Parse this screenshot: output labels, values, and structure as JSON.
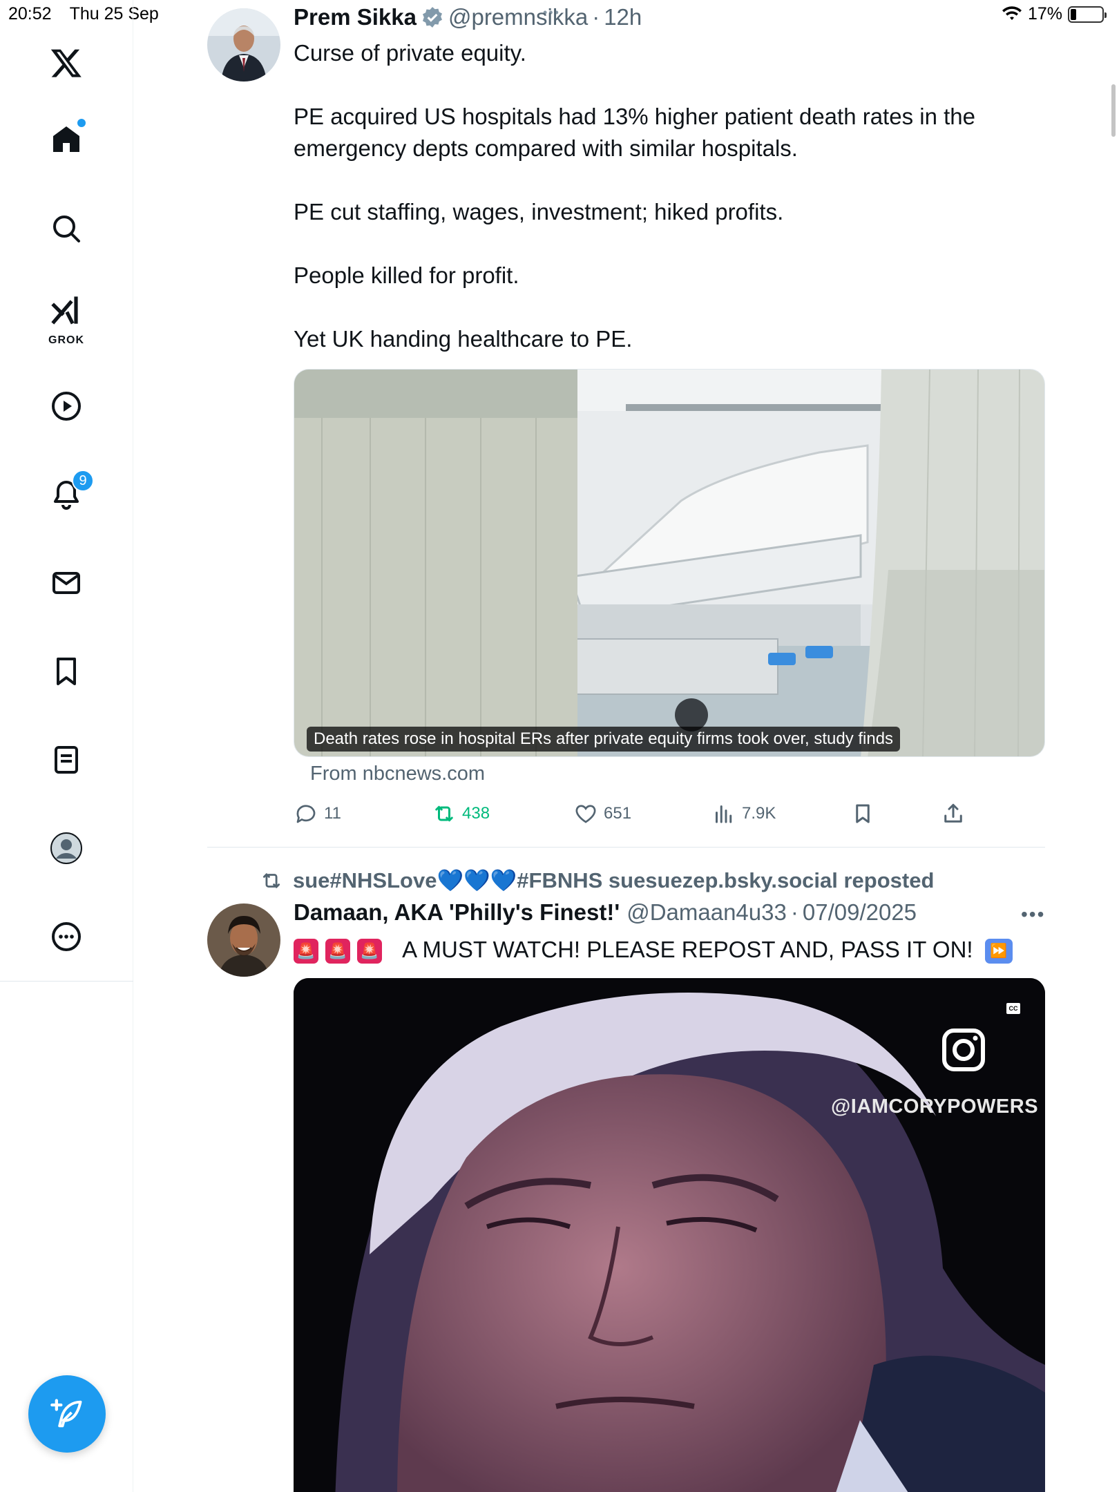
{
  "status_bar": {
    "time": "20:52",
    "date": "Thu 25 Sep",
    "battery": "17%"
  },
  "sidebar": {
    "grok_label": "GROK",
    "notification_count": "9"
  },
  "tweet1": {
    "author_name": "Prem Sikka",
    "handle": "@premnsikka",
    "separator": "·",
    "time": "12h",
    "text": "Curse of private equity.\n\nPE acquired US hospitals had 13% higher patient death rates in the emergency depts compared with similar hospitals.\n\nPE cut staffing, wages, investment; hiked profits.\n\nPeople killed for profit.\n\nYet UK handing healthcare to PE.",
    "card_caption": "Death rates rose in hospital ERs after private equity firms took over, study finds",
    "card_source": "From nbcnews.com",
    "stats": {
      "replies": "11",
      "reposts": "438",
      "likes": "651",
      "views": "7.9K"
    }
  },
  "tweet2": {
    "reposted_by": "sue#NHSLove",
    "reposted_by_suffix": "#FBNHS suesuezep.bsky.social reposted",
    "hearts": "💙💙💙",
    "author_name": "Damaan, AKA 'Philly's Finest!'",
    "handle": "@Damaan4u33",
    "separator": "·",
    "time": "07/09/2025",
    "text": "A MUST WATCH!  PLEASE REPOST AND, PASS IT ON!",
    "video_watermark": "@IAMCORYPOWERS",
    "cc": "CC"
  },
  "colors": {
    "accent": "#1d9bf0",
    "repost_green": "#00ba7c",
    "muted": "#536471"
  }
}
